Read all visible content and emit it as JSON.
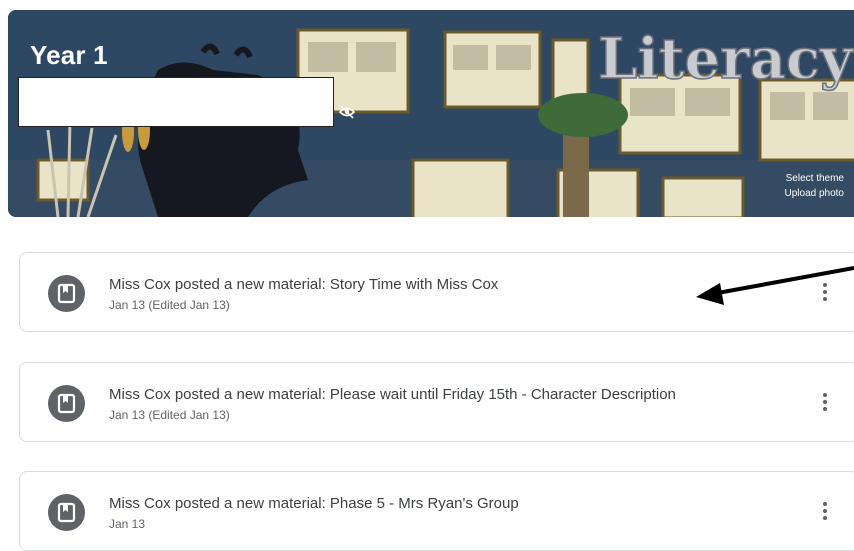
{
  "banner": {
    "class_name": "Year 1",
    "wall_text": "Literacy",
    "select_theme": "Select theme",
    "upload_photo": "Upload photo",
    "colors": {
      "background": "#2f4a66",
      "text": "#ffffff"
    }
  },
  "stream": {
    "posts": [
      {
        "title": "Miss Cox posted a new material: Story Time with Miss Cox",
        "date": "Jan 13 (Edited Jan 13)"
      },
      {
        "title": "Miss Cox posted a new material: Please wait until Friday 15th - Character Description",
        "date": "Jan 13 (Edited Jan 13)"
      },
      {
        "title": "Miss Cox posted a new material: Phase 5 - Mrs Ryan's Group",
        "date": "Jan 13"
      }
    ],
    "icons": {
      "post": "book-icon",
      "menu": "more-vert-icon"
    }
  },
  "colors": {
    "icon_bg": "#5f6368",
    "border": "#dadce0",
    "title": "#3c4043",
    "meta": "#5f6368"
  }
}
